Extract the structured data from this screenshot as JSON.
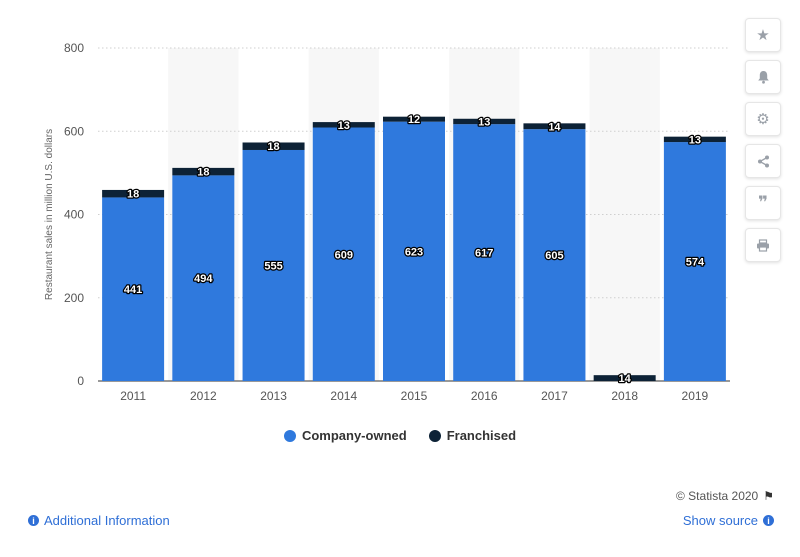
{
  "chart_data": {
    "type": "bar",
    "stacked": true,
    "categories": [
      "2011",
      "2012",
      "2013",
      "2014",
      "2015",
      "2016",
      "2017",
      "2018",
      "2019"
    ],
    "series": [
      {
        "name": "Company-owned",
        "color": "#2f79dd",
        "values": [
          441,
          494,
          555,
          609,
          623,
          617,
          605,
          0,
          574
        ]
      },
      {
        "name": "Franchised",
        "color": "#0d2236",
        "values": [
          18,
          18,
          18,
          13,
          12,
          13,
          14,
          14,
          13
        ]
      }
    ],
    "ylabel": "Restaurant sales in million U.S. dollars",
    "ylim": [
      0,
      800
    ],
    "yticks": [
      0,
      200,
      400,
      600,
      800
    ],
    "grid": true,
    "legend": "bottom-center"
  },
  "legend": {
    "items": [
      {
        "label": "Company-owned",
        "color": "#2f79dd"
      },
      {
        "label": "Franchised",
        "color": "#0d2236"
      }
    ]
  },
  "footer": {
    "copyright": "© Statista 2020",
    "additional_info": "Additional Information",
    "show_source": "Show source"
  },
  "sidebar": {
    "icons": [
      "star-icon",
      "bell-icon",
      "gear-icon",
      "share-icon",
      "quote-icon",
      "print-icon"
    ]
  }
}
